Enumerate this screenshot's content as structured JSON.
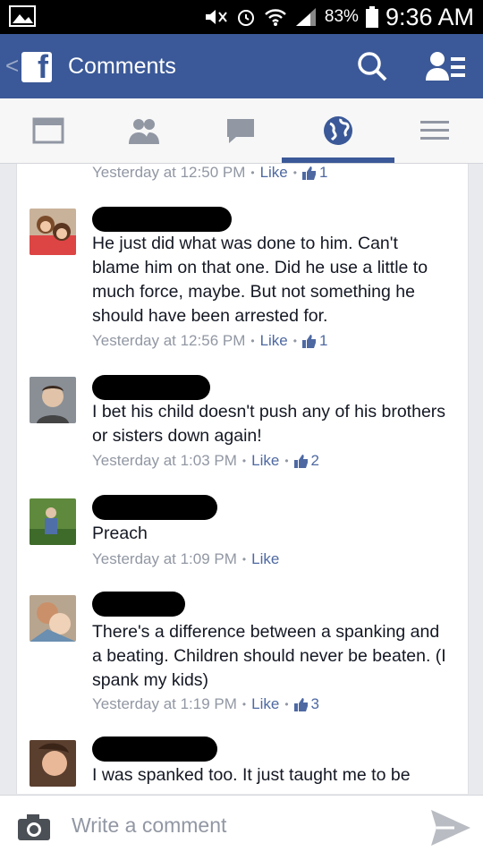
{
  "statusbar": {
    "battery": "83%",
    "time": "9:36 AM"
  },
  "appbar": {
    "title": "Comments",
    "logo_letter": "f",
    "back": "<"
  },
  "tabs": [
    {
      "icon": "news-feed-icon"
    },
    {
      "icon": "friends-icon"
    },
    {
      "icon": "messages-icon"
    },
    {
      "icon": "globe-notifications-icon"
    },
    {
      "icon": "menu-icon"
    }
  ],
  "top_meta": {
    "time": "Yesterday at 12:50 PM",
    "like_label": "Like",
    "likes": "1"
  },
  "comments": [
    {
      "text": "He just did what was done to him. Can't blame him on that one. Did he use a little to much force, maybe. But not something he should have been arrested for.",
      "time": "Yesterday at 12:56 PM",
      "like_label": "Like",
      "likes": "1"
    },
    {
      "text": "I bet his child doesn't push any of his brothers or sisters down again!",
      "time": "Yesterday at 1:03 PM",
      "like_label": "Like",
      "likes": "2"
    },
    {
      "text": "Preach",
      "time": "Yesterday at 1:09 PM",
      "like_label": "Like",
      "likes": ""
    },
    {
      "text": "There's a difference between a spanking and a beating. Children should never be beaten. (I spank my kids)",
      "time": "Yesterday at 1:19 PM",
      "like_label": "Like",
      "likes": "3"
    },
    {
      "text": "I was spanked too. It just taught me to be",
      "time": "",
      "like_label": "",
      "likes": ""
    }
  ],
  "composer": {
    "placeholder": "Write a comment"
  },
  "colors": {
    "brand": "#3b5998",
    "link": "#4e69a2",
    "meta": "#9197a3"
  }
}
